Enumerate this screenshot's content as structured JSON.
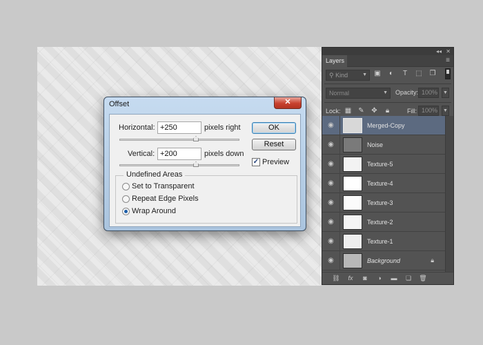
{
  "layers_panel": {
    "tab_label": "Layers",
    "collapse_glyph": "◂◂",
    "close_glyph": "✕",
    "menu_glyph": "≡",
    "filter": {
      "kind_label": "Kind"
    },
    "blend_mode": "Normal",
    "opacity_label": "Opacity:",
    "opacity_value": "100%",
    "lock_label": "Lock:",
    "fill_label": "Fill:",
    "fill_value": "100%",
    "layers": [
      {
        "name": "Merged-Copy",
        "selected": true,
        "thumb_color": "#d8d8d8"
      },
      {
        "name": "Noise",
        "selected": false,
        "thumb_color": "#7a7a7a"
      },
      {
        "name": "Texture-5",
        "selected": false,
        "thumb_color": "#f3f3f3"
      },
      {
        "name": "Texture-4",
        "selected": false,
        "thumb_color": "#ffffff"
      },
      {
        "name": "Texture-3",
        "selected": false,
        "thumb_color": "#fbfbfb"
      },
      {
        "name": "Texture-2",
        "selected": false,
        "thumb_color": "#f5f5f5"
      },
      {
        "name": "Texture-1",
        "selected": false,
        "thumb_color": "#eeeeee"
      },
      {
        "name": "Background",
        "selected": false,
        "thumb_color": "#b8b8b8",
        "locked": true
      }
    ]
  },
  "offset_dialog": {
    "title": "Offset",
    "close_glyph": "✕",
    "horizontal_label": "Horizontal:",
    "horizontal_value": "+250",
    "horizontal_unit": "pixels right",
    "vertical_label": "Vertical:",
    "vertical_value": "+200",
    "vertical_unit": "pixels down",
    "ok_label": "OK",
    "reset_label": "Reset",
    "preview_label": "Preview",
    "preview_checked": true,
    "undefined_areas_title": "Undefined Areas",
    "options": [
      {
        "label": "Set to Transparent",
        "selected": false
      },
      {
        "label": "Repeat Edge Pixels",
        "selected": false
      },
      {
        "label": "Wrap Around",
        "selected": true
      }
    ]
  }
}
